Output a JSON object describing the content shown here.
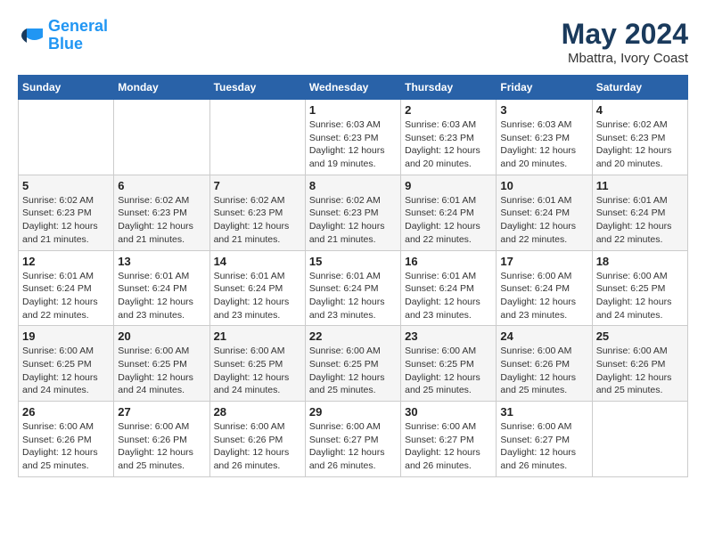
{
  "header": {
    "logo_line1": "General",
    "logo_line2": "Blue",
    "month": "May 2024",
    "location": "Mbattra, Ivory Coast"
  },
  "weekdays": [
    "Sunday",
    "Monday",
    "Tuesday",
    "Wednesday",
    "Thursday",
    "Friday",
    "Saturday"
  ],
  "weeks": [
    [
      {
        "day": "",
        "info": ""
      },
      {
        "day": "",
        "info": ""
      },
      {
        "day": "",
        "info": ""
      },
      {
        "day": "1",
        "info": "Sunrise: 6:03 AM\nSunset: 6:23 PM\nDaylight: 12 hours\nand 19 minutes."
      },
      {
        "day": "2",
        "info": "Sunrise: 6:03 AM\nSunset: 6:23 PM\nDaylight: 12 hours\nand 20 minutes."
      },
      {
        "day": "3",
        "info": "Sunrise: 6:03 AM\nSunset: 6:23 PM\nDaylight: 12 hours\nand 20 minutes."
      },
      {
        "day": "4",
        "info": "Sunrise: 6:02 AM\nSunset: 6:23 PM\nDaylight: 12 hours\nand 20 minutes."
      }
    ],
    [
      {
        "day": "5",
        "info": "Sunrise: 6:02 AM\nSunset: 6:23 PM\nDaylight: 12 hours\nand 21 minutes."
      },
      {
        "day": "6",
        "info": "Sunrise: 6:02 AM\nSunset: 6:23 PM\nDaylight: 12 hours\nand 21 minutes."
      },
      {
        "day": "7",
        "info": "Sunrise: 6:02 AM\nSunset: 6:23 PM\nDaylight: 12 hours\nand 21 minutes."
      },
      {
        "day": "8",
        "info": "Sunrise: 6:02 AM\nSunset: 6:23 PM\nDaylight: 12 hours\nand 21 minutes."
      },
      {
        "day": "9",
        "info": "Sunrise: 6:01 AM\nSunset: 6:24 PM\nDaylight: 12 hours\nand 22 minutes."
      },
      {
        "day": "10",
        "info": "Sunrise: 6:01 AM\nSunset: 6:24 PM\nDaylight: 12 hours\nand 22 minutes."
      },
      {
        "day": "11",
        "info": "Sunrise: 6:01 AM\nSunset: 6:24 PM\nDaylight: 12 hours\nand 22 minutes."
      }
    ],
    [
      {
        "day": "12",
        "info": "Sunrise: 6:01 AM\nSunset: 6:24 PM\nDaylight: 12 hours\nand 22 minutes."
      },
      {
        "day": "13",
        "info": "Sunrise: 6:01 AM\nSunset: 6:24 PM\nDaylight: 12 hours\nand 23 minutes."
      },
      {
        "day": "14",
        "info": "Sunrise: 6:01 AM\nSunset: 6:24 PM\nDaylight: 12 hours\nand 23 minutes."
      },
      {
        "day": "15",
        "info": "Sunrise: 6:01 AM\nSunset: 6:24 PM\nDaylight: 12 hours\nand 23 minutes."
      },
      {
        "day": "16",
        "info": "Sunrise: 6:01 AM\nSunset: 6:24 PM\nDaylight: 12 hours\nand 23 minutes."
      },
      {
        "day": "17",
        "info": "Sunrise: 6:00 AM\nSunset: 6:24 PM\nDaylight: 12 hours\nand 23 minutes."
      },
      {
        "day": "18",
        "info": "Sunrise: 6:00 AM\nSunset: 6:25 PM\nDaylight: 12 hours\nand 24 minutes."
      }
    ],
    [
      {
        "day": "19",
        "info": "Sunrise: 6:00 AM\nSunset: 6:25 PM\nDaylight: 12 hours\nand 24 minutes."
      },
      {
        "day": "20",
        "info": "Sunrise: 6:00 AM\nSunset: 6:25 PM\nDaylight: 12 hours\nand 24 minutes."
      },
      {
        "day": "21",
        "info": "Sunrise: 6:00 AM\nSunset: 6:25 PM\nDaylight: 12 hours\nand 24 minutes."
      },
      {
        "day": "22",
        "info": "Sunrise: 6:00 AM\nSunset: 6:25 PM\nDaylight: 12 hours\nand 25 minutes."
      },
      {
        "day": "23",
        "info": "Sunrise: 6:00 AM\nSunset: 6:25 PM\nDaylight: 12 hours\nand 25 minutes."
      },
      {
        "day": "24",
        "info": "Sunrise: 6:00 AM\nSunset: 6:26 PM\nDaylight: 12 hours\nand 25 minutes."
      },
      {
        "day": "25",
        "info": "Sunrise: 6:00 AM\nSunset: 6:26 PM\nDaylight: 12 hours\nand 25 minutes."
      }
    ],
    [
      {
        "day": "26",
        "info": "Sunrise: 6:00 AM\nSunset: 6:26 PM\nDaylight: 12 hours\nand 25 minutes."
      },
      {
        "day": "27",
        "info": "Sunrise: 6:00 AM\nSunset: 6:26 PM\nDaylight: 12 hours\nand 25 minutes."
      },
      {
        "day": "28",
        "info": "Sunrise: 6:00 AM\nSunset: 6:26 PM\nDaylight: 12 hours\nand 26 minutes."
      },
      {
        "day": "29",
        "info": "Sunrise: 6:00 AM\nSunset: 6:27 PM\nDaylight: 12 hours\nand 26 minutes."
      },
      {
        "day": "30",
        "info": "Sunrise: 6:00 AM\nSunset: 6:27 PM\nDaylight: 12 hours\nand 26 minutes."
      },
      {
        "day": "31",
        "info": "Sunrise: 6:00 AM\nSunset: 6:27 PM\nDaylight: 12 hours\nand 26 minutes."
      },
      {
        "day": "",
        "info": ""
      }
    ]
  ]
}
